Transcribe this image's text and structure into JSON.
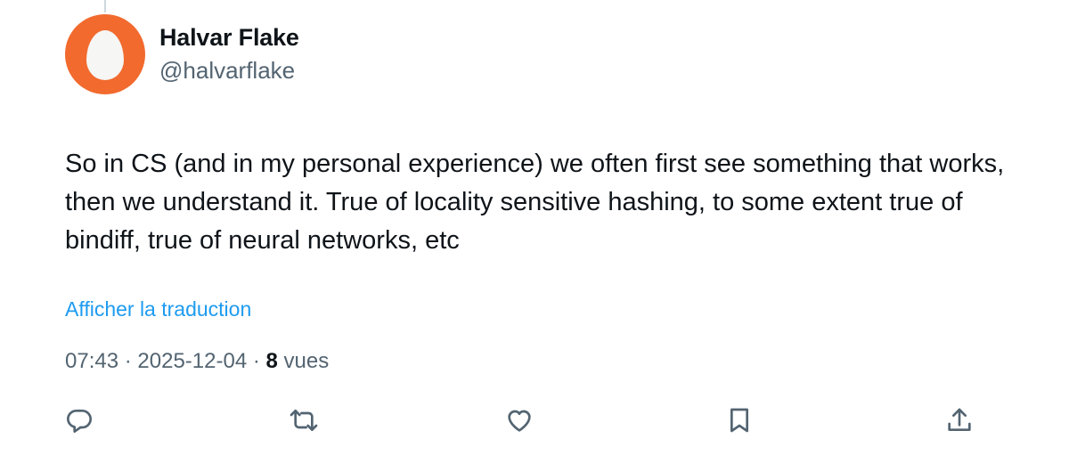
{
  "author": {
    "display_name": "Halvar Flake",
    "handle": "@halvarflake",
    "avatar_icon": "egg-avatar-icon",
    "avatar_color": "#f26a2e"
  },
  "tweet": {
    "text": "So in CS (and in my personal experience) we often first see something that works, then we understand it. True of locality sensitive hashing, to some extent true of bindiff, true of neural networks, etc",
    "translate_label": "Afficher la traduction",
    "time": "07:43",
    "separator": "·",
    "date": "2025-12-04",
    "views_count": "8",
    "views_label": "vues"
  },
  "actions": [
    {
      "name": "reply",
      "icon": "reply-icon"
    },
    {
      "name": "retweet",
      "icon": "retweet-icon"
    },
    {
      "name": "like",
      "icon": "heart-icon"
    },
    {
      "name": "bookmark",
      "icon": "bookmark-icon"
    },
    {
      "name": "share",
      "icon": "share-icon"
    }
  ],
  "colors": {
    "link": "#1d9bf0",
    "secondary_text": "#536471",
    "primary_text": "#0f1419"
  }
}
